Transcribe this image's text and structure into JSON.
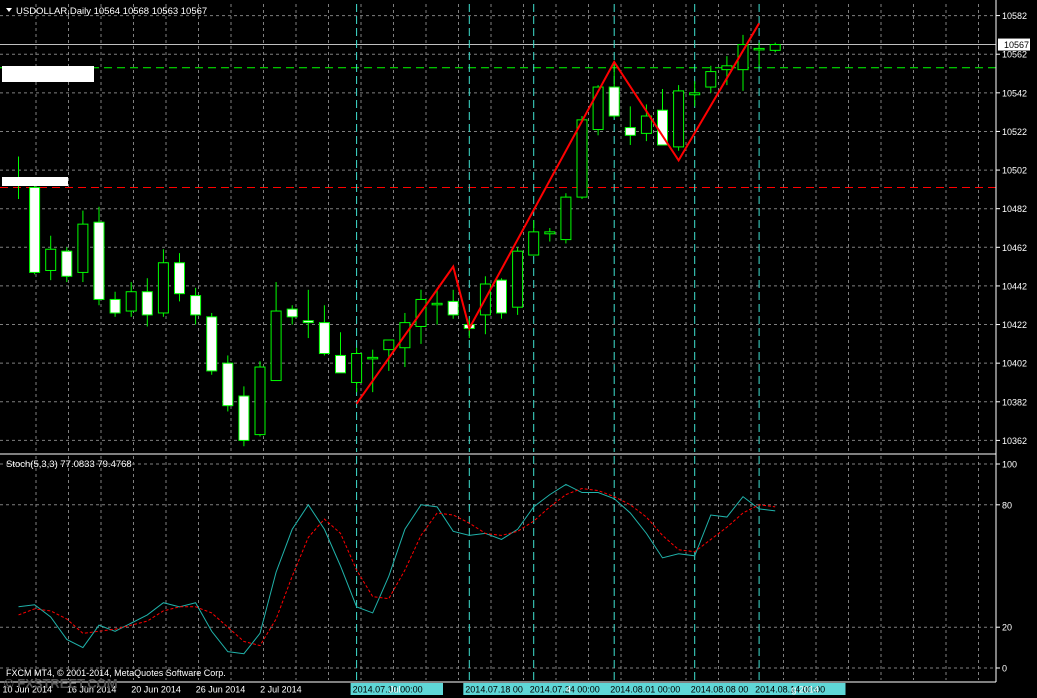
{
  "header": {
    "symbol_line": "USDOLLAR,Daily  10564 10568 10563 10567",
    "stoch_line": "Stoch(5,3,3) 77.0833 79.4768",
    "copyright": "FXCM MT4, © 2001-2014, MetaQuotes Software Corp.",
    "watermark": "© FXSTREET.COM"
  },
  "colors": {
    "background": "#000000",
    "grid": "#7f7f7f",
    "bull_candle": "#000000",
    "bull_border": "#00ff00",
    "bear_candle": "#ffffff",
    "wick": "#00ff00",
    "zigzag": "#ff0000",
    "stoch_main": "#20b2aa",
    "stoch_signal": "#ff0000",
    "cursor_line": "#40e0d0",
    "level_green": "#00ff00",
    "level_red": "#ff0000",
    "axis_text": "#ffffff",
    "price_tag_bg": "#ffffff",
    "price_tag_text": "#000000",
    "date_tag_bg": "#5fd7d7",
    "date_tag_text": "#000000"
  },
  "chart_data": [
    {
      "type": "candlestick",
      "title": "USDOLLAR,Daily",
      "ohlc_header": "10564 10568 10563 10567",
      "y_ticks": [
        "10582",
        "10562",
        "10542",
        "10522",
        "10502",
        "10482",
        "10462",
        "10442",
        "10422",
        "10402",
        "10382",
        "10362"
      ],
      "ylim": [
        10356,
        10588
      ],
      "current_price": "10567",
      "candles": [
        {
          "o": 10495,
          "h": 10509,
          "l": 10487,
          "c": 10498
        },
        {
          "o": 10493,
          "h": 10497,
          "l": 10448,
          "c": 10449
        },
        {
          "o": 10450,
          "h": 10468,
          "l": 10445,
          "c": 10461
        },
        {
          "o": 10460,
          "h": 10462,
          "l": 10444,
          "c": 10447
        },
        {
          "o": 10449,
          "h": 10481,
          "l": 10444,
          "c": 10474
        },
        {
          "o": 10475,
          "h": 10483,
          "l": 10432,
          "c": 10435
        },
        {
          "o": 10435,
          "h": 10439,
          "l": 10426,
          "c": 10428
        },
        {
          "o": 10429,
          "h": 10444,
          "l": 10426,
          "c": 10439
        },
        {
          "o": 10439,
          "h": 10446,
          "l": 10421,
          "c": 10427
        },
        {
          "o": 10428,
          "h": 10461,
          "l": 10426,
          "c": 10454
        },
        {
          "o": 10454,
          "h": 10459,
          "l": 10434,
          "c": 10438
        },
        {
          "o": 10437,
          "h": 10441,
          "l": 10422,
          "c": 10427
        },
        {
          "o": 10426,
          "h": 10428,
          "l": 10396,
          "c": 10398
        },
        {
          "o": 10402,
          "h": 10406,
          "l": 10377,
          "c": 10380
        },
        {
          "o": 10385,
          "h": 10390,
          "l": 10359,
          "c": 10362
        },
        {
          "o": 10365,
          "h": 10403,
          "l": 10364,
          "c": 10400
        },
        {
          "o": 10393,
          "h": 10444,
          "l": 10393,
          "c": 10429
        },
        {
          "o": 10430,
          "h": 10432,
          "l": 10422,
          "c": 10426
        },
        {
          "o": 10424,
          "h": 10440,
          "l": 10415,
          "c": 10423
        },
        {
          "o": 10423,
          "h": 10432,
          "l": 10406,
          "c": 10407
        },
        {
          "o": 10406,
          "h": 10418,
          "l": 10397,
          "c": 10397
        },
        {
          "o": 10392,
          "h": 10410,
          "l": 10387,
          "c": 10407
        },
        {
          "o": 10405,
          "h": 10409,
          "l": 10387,
          "c": 10405
        },
        {
          "o": 10409,
          "h": 10414,
          "l": 10398,
          "c": 10414
        },
        {
          "o": 10410,
          "h": 10428,
          "l": 10400,
          "c": 10423
        },
        {
          "o": 10421,
          "h": 10440,
          "l": 10412,
          "c": 10435
        },
        {
          "o": 10433,
          "h": 10440,
          "l": 10422,
          "c": 10433
        },
        {
          "o": 10434,
          "h": 10440,
          "l": 10425,
          "c": 10427
        },
        {
          "o": 10422,
          "h": 10425,
          "l": 10415,
          "c": 10420
        },
        {
          "o": 10427,
          "h": 10447,
          "l": 10417,
          "c": 10443
        },
        {
          "o": 10445,
          "h": 10446,
          "l": 10425,
          "c": 10428
        },
        {
          "o": 10431,
          "h": 10462,
          "l": 10427,
          "c": 10460
        },
        {
          "o": 10458,
          "h": 10476,
          "l": 10458,
          "c": 10470
        },
        {
          "o": 10469,
          "h": 10472,
          "l": 10465,
          "c": 10470
        },
        {
          "o": 10466,
          "h": 10490,
          "l": 10464,
          "c": 10488
        },
        {
          "o": 10488,
          "h": 10530,
          "l": 10487,
          "c": 10528
        },
        {
          "o": 10523,
          "h": 10546,
          "l": 10520,
          "c": 10545
        },
        {
          "o": 10545,
          "h": 10558,
          "l": 10529,
          "c": 10530
        },
        {
          "o": 10524,
          "h": 10535,
          "l": 10515,
          "c": 10520
        },
        {
          "o": 10521,
          "h": 10536,
          "l": 10517,
          "c": 10530
        },
        {
          "o": 10533,
          "h": 10544,
          "l": 10520,
          "c": 10515
        },
        {
          "o": 10514,
          "h": 10546,
          "l": 10512,
          "c": 10543
        },
        {
          "o": 10541,
          "h": 10548,
          "l": 10535,
          "c": 10542
        },
        {
          "o": 10545,
          "h": 10556,
          "l": 10542,
          "c": 10553
        },
        {
          "o": 10554,
          "h": 10561,
          "l": 10546,
          "c": 10556
        },
        {
          "o": 10554,
          "h": 10572,
          "l": 10543,
          "c": 10567
        },
        {
          "o": 10565,
          "h": 10568,
          "l": 10556,
          "c": 10565
        },
        {
          "o": 10564,
          "h": 10568,
          "l": 10563,
          "c": 10567
        }
      ],
      "zigzag": [
        {
          "i": 21,
          "p": 10381
        },
        {
          "i": 27,
          "p": 10452
        },
        {
          "i": 28,
          "p": 10420
        },
        {
          "i": 37,
          "p": 10558
        },
        {
          "i": 41,
          "p": 10507
        },
        {
          "i": 46,
          "p": 10578
        }
      ],
      "levels": [
        {
          "price": 10555,
          "color": "green",
          "style": "dashed"
        },
        {
          "price": 10493,
          "color": "red",
          "style": "dashed"
        },
        {
          "price": 10567,
          "color": "white",
          "style": "solid"
        }
      ],
      "vertical_markers": [
        21,
        28,
        32,
        37,
        42,
        46
      ]
    },
    {
      "type": "line",
      "title": "Stoch(5,3,3) 77.0833 79.4768",
      "y_ticks": [
        "100",
        "80",
        "20",
        "0"
      ],
      "ylim": [
        0,
        100
      ],
      "series": [
        {
          "name": "main",
          "values": [
            30,
            31,
            25,
            14,
            10,
            21,
            18,
            22,
            26,
            32,
            30,
            32,
            18,
            8,
            7,
            17,
            47,
            68,
            80,
            68,
            50,
            30,
            27,
            45,
            68,
            80,
            79,
            67,
            65,
            66,
            63,
            68,
            79,
            85,
            90,
            86,
            86,
            83,
            76,
            66,
            54,
            56,
            55,
            75,
            74,
            84,
            78,
            77
          ]
        },
        {
          "name": "signal",
          "values": [
            26,
            29,
            28,
            24,
            17,
            18,
            19,
            21,
            23,
            28,
            30,
            30,
            27,
            20,
            13,
            11,
            24,
            45,
            64,
            73,
            66,
            48,
            35,
            34,
            48,
            65,
            76,
            75,
            71,
            66,
            65,
            67,
            72,
            79,
            85,
            88,
            87,
            84,
            80,
            74,
            65,
            58,
            57,
            63,
            69,
            76,
            80,
            79
          ]
        }
      ]
    }
  ],
  "x_axis": {
    "labels": [
      {
        "i": 0,
        "text": "10 Jun 2014"
      },
      {
        "i": 4,
        "text": "16 Jun 2014"
      },
      {
        "i": 8,
        "text": "20 Jun 2014"
      },
      {
        "i": 12,
        "text": "26 Jun 2014"
      },
      {
        "i": 16,
        "text": "2 Jul 2014"
      },
      {
        "i": 21,
        "text": "2014.07.10 00:00",
        "tag": true
      },
      {
        "i": 24,
        "text": "Jul"
      },
      {
        "i": 28,
        "text": "2014.07.18 00",
        "tag": true
      },
      {
        "i": 32,
        "text": "2014.07.24 00:00",
        "tag": true
      },
      {
        "i": 35,
        "text": "4"
      },
      {
        "i": 37,
        "text": "2014.08.01 00:00",
        "tag": true
      },
      {
        "i": 42,
        "text": "2014.08.08 00",
        "tag": true
      },
      {
        "i": 46,
        "text": "2014.08.14 00:00",
        "tag": true
      },
      {
        "i": 49,
        "text": "g 2014"
      }
    ]
  }
}
